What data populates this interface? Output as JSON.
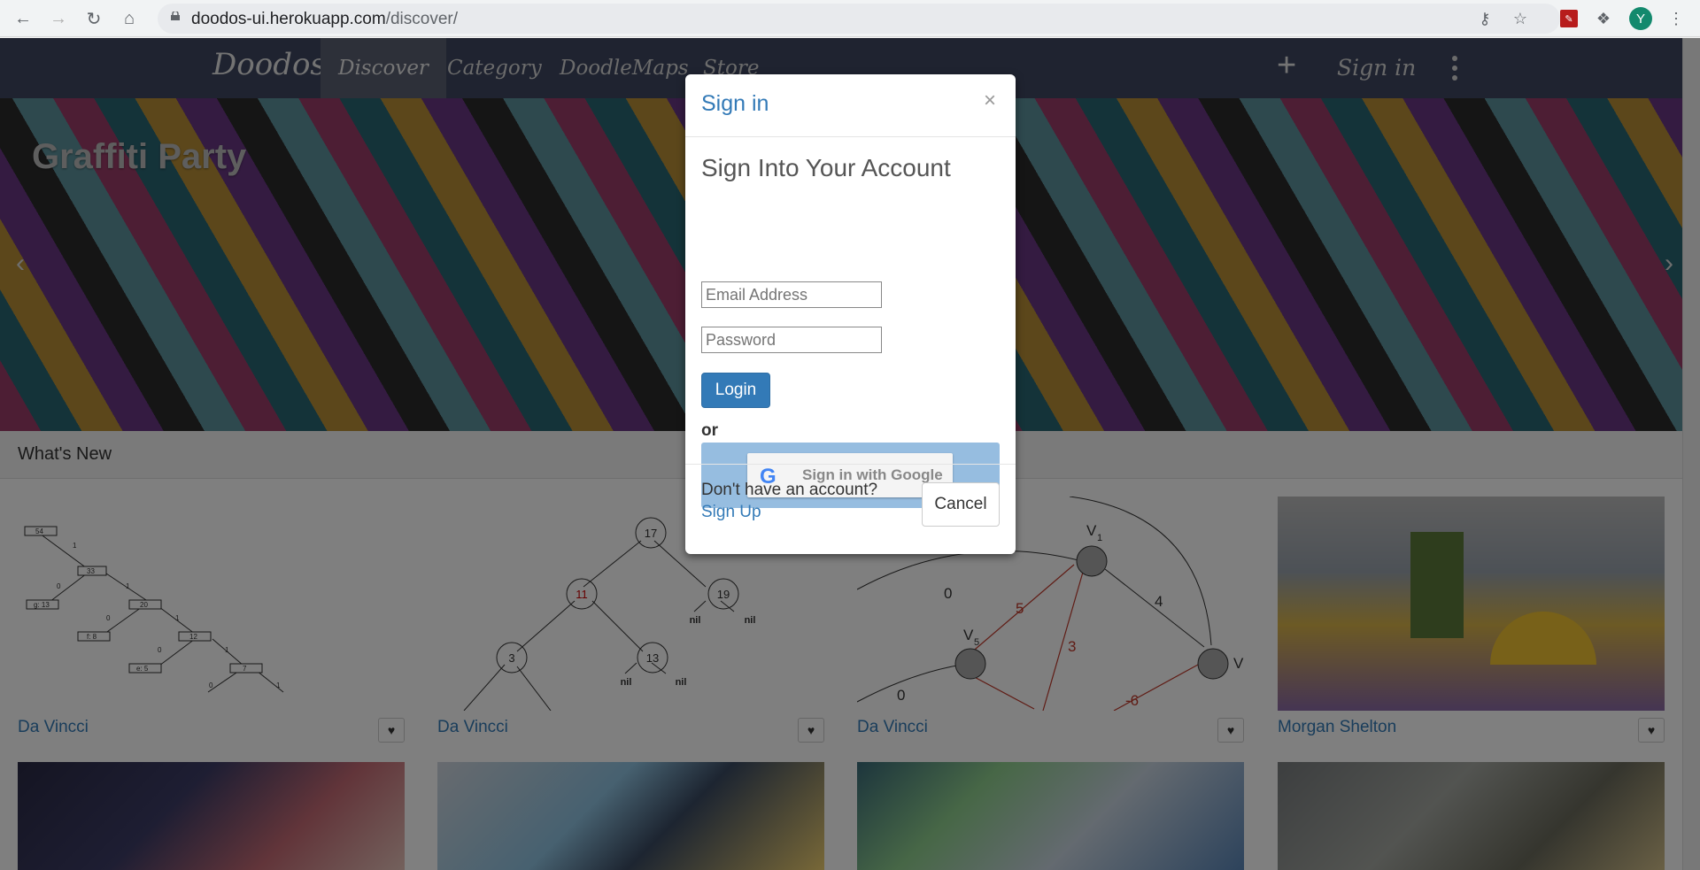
{
  "browser": {
    "url_host": "doodos-ui.herokuapp.com",
    "url_path": "/discover/",
    "avatar_letter": "Y"
  },
  "nav": {
    "brand": "Doodos",
    "items": [
      {
        "label": "Discover",
        "active": true
      },
      {
        "label": "Category"
      },
      {
        "label": "DoodleMaps"
      },
      {
        "label": "Store"
      }
    ],
    "plus": "+",
    "signin": "Sign in"
  },
  "hero": {
    "title": "Graffiti Party",
    "prev": "‹",
    "next": "›"
  },
  "section": {
    "title": "What's New"
  },
  "cards": [
    {
      "author": "Da Vincci"
    },
    {
      "author": "Da Vincci"
    },
    {
      "author": "Da Vincci"
    },
    {
      "author": "Morgan Shelton"
    }
  ],
  "modal": {
    "title": "Sign in",
    "close": "×",
    "heading": "Sign Into Your Account",
    "email_placeholder": "Email Address",
    "password_placeholder": "Password",
    "login_label": "Login",
    "or_label": "or",
    "google_label": "Sign in with Google",
    "google_g": "G",
    "no_account": "Don't have an account?",
    "signup_label": "Sign Up",
    "cancel_label": "Cancel"
  },
  "tree1": {
    "nodes": [
      "54",
      "33",
      "g: 13",
      "20",
      "f: 8",
      "12",
      "e: 5",
      "7"
    ],
    "edges": [
      "1",
      "0",
      "1",
      "0",
      "1",
      "0",
      "1",
      "0",
      "1"
    ]
  },
  "tree2": {
    "nodes": [
      "17",
      "11",
      "19",
      "3",
      "13"
    ],
    "nils": [
      "nil",
      "nil",
      "nil",
      "nil"
    ]
  },
  "graph3": {
    "nodes": [
      "V",
      "1",
      "V",
      "5",
      "V"
    ],
    "weights": [
      "0",
      "5",
      "4",
      "3",
      "0",
      "-6"
    ]
  },
  "colors": {
    "navbar": "#3e4760",
    "link": "#337ab7",
    "login_bg": "#337ab7",
    "google_wrap": "#96bde0"
  }
}
